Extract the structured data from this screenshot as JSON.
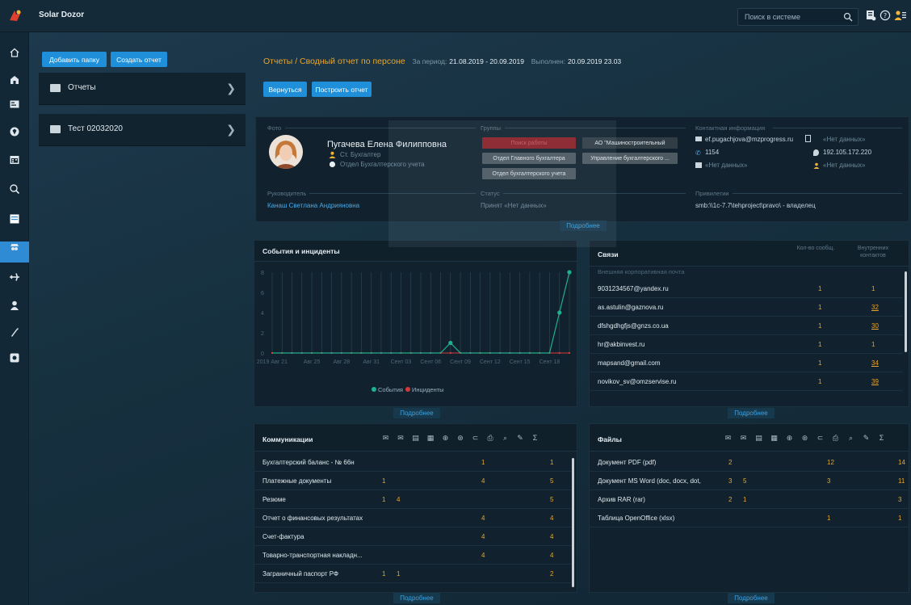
{
  "app": {
    "name": "Solar Dozor"
  },
  "search": {
    "placeholder": "Поиск в системе"
  },
  "leftpane": {
    "add_folder": "Добавить папку",
    "create_report": "Создать отчет",
    "folders": [
      {
        "label": "Отчеты"
      },
      {
        "label": "Тест 02032020"
      }
    ]
  },
  "breadcrumb": {
    "title": "Отчеты / Сводный отчет по персоне",
    "period_label": "За период:",
    "period_value": "21.08.2019 - 20.09.2019",
    "done_label": "Выполнен:",
    "done_value": "20.09.2019 23.03"
  },
  "actions": {
    "back": "Вернуться",
    "build": "Построить отчет"
  },
  "person": {
    "section_photo": "Фото",
    "name": "Пугачева Елена Филипповна",
    "position": "Ст. Бухгалтер",
    "department": "Отдел Бухгалтерского учета",
    "section_manager": "Руководитель",
    "manager": "Канаш Светлана Андрияновна",
    "section_groups": "Группы",
    "groups": [
      "Поиск работы",
      "АО \"Машиностроительный",
      "Отдел Главного бухгалтера",
      "Управление бухгалтерского ...",
      "Отдел бухгалтерского учета"
    ],
    "section_status": "Статус",
    "status": "Принят «Нет данных»",
    "section_contacts": "Контактная информация",
    "email": "ef.pugachjova@mzprogress.ru",
    "phone": "1154",
    "ip": "192.105.172.220",
    "no_data": "«Нет данных»",
    "section_rights": "Привилегии",
    "rights": "smb:\\\\1c-7.7\\tehproject\\pravo\\ - владелец",
    "more": "Подробнее"
  },
  "events": {
    "title": "События и инциденты",
    "more": "Подробнее",
    "legend": {
      "events": "События",
      "incidents": "Инциденты"
    },
    "colors": {
      "events": "#1fb08e",
      "incidents": "#d23a3a"
    }
  },
  "chart_data": {
    "type": "line",
    "x": [
      "2019 Авг 21",
      "Авг 22",
      "Авг 23",
      "Авг 24",
      "Авг 25",
      "Авг 26",
      "Авг 27",
      "Авг 28",
      "Авг 29",
      "Авг 30",
      "Авг 31",
      "Сент 01",
      "Сент 02",
      "Сент 03",
      "Сент 04",
      "Сент 05",
      "Сент 06",
      "Сент 07",
      "Сент 08",
      "Сент 09",
      "Сент 10",
      "Сент 11",
      "Сент 12",
      "Сент 13",
      "Сент 14",
      "Сент 15",
      "Сент 16",
      "Сент 17",
      "Сент 18",
      "Сент 19",
      "Сент 20"
    ],
    "xticks": [
      "2019 Авг 21",
      "Авг 25",
      "Авг 28",
      "Авг 31",
      "Сент 03",
      "Сент 06",
      "Сент 09",
      "Сент 12",
      "Сент 15",
      "Сент 18"
    ],
    "yticks": [
      "0",
      "2",
      "4",
      "6",
      "8"
    ],
    "ylim": [
      0,
      8
    ],
    "series": [
      {
        "name": "События",
        "values": [
          0,
          0,
          0,
          0,
          0,
          0,
          0,
          0,
          0,
          0,
          0,
          0,
          0,
          0,
          0,
          0,
          0,
          0,
          1,
          0,
          0,
          0,
          0,
          0,
          0,
          0,
          0,
          0,
          0,
          4,
          8
        ]
      },
      {
        "name": "Инциденты",
        "values": [
          0,
          0,
          0,
          0,
          0,
          0,
          0,
          0,
          0,
          0,
          0,
          0,
          0,
          0,
          0,
          0,
          0,
          0,
          0,
          0,
          0,
          0,
          0,
          0,
          0,
          0,
          0,
          0,
          0,
          0,
          0
        ]
      }
    ]
  },
  "links": {
    "title": "Связи",
    "col1": "Кол-во сообщ.",
    "col2": "Внутренних контактов",
    "group": "Внешняя корпоративная почта",
    "more": "Подробнее",
    "rows": [
      {
        "email": "9031234567@yandex.ru",
        "count": "1",
        "internal": "1"
      },
      {
        "email": "as.astulin@gaznova.ru",
        "count": "1",
        "internal": "32"
      },
      {
        "email": "dfshgdhgfjs@gnzs.co.ua",
        "count": "1",
        "internal": "30"
      },
      {
        "email": "hr@akbinvest.ru",
        "count": "1",
        "internal": "1"
      },
      {
        "email": "mapsand@gmail.com",
        "count": "1",
        "internal": "34"
      },
      {
        "email": "novikov_sv@omzservise.ru",
        "count": "1",
        "internal": "39"
      }
    ]
  },
  "communications": {
    "title": "Коммуникации",
    "more": "Подробнее",
    "rows": [
      {
        "name": "Бухгалтерский баланс - № 66н",
        "a": "",
        "b": "",
        "c": "1",
        "total": "1"
      },
      {
        "name": "Платежные документы",
        "a": "1",
        "b": "",
        "c": "4",
        "total": "5"
      },
      {
        "name": "Резюме",
        "a": "1",
        "b": "4",
        "c": "",
        "total": "5"
      },
      {
        "name": "Отчет о финансовых результатах",
        "a": "",
        "b": "",
        "c": "4",
        "total": "4"
      },
      {
        "name": "Счет-фактура",
        "a": "",
        "b": "",
        "c": "4",
        "total": "4"
      },
      {
        "name": "Товарно-транспортная накладн...",
        "a": "",
        "b": "",
        "c": "4",
        "total": "4"
      },
      {
        "name": "Заграничный паспорт РФ",
        "a": "1",
        "b": "1",
        "c": "",
        "total": "2"
      }
    ]
  },
  "files": {
    "title": "Файлы",
    "more": "Подробнее",
    "rows": [
      {
        "name": "Документ PDF (pdf)",
        "a": "2",
        "b": "",
        "c": "12",
        "total": "14"
      },
      {
        "name": "Документ MS Word (doc, docx, dot,",
        "a": "3",
        "b": "5",
        "c": "3",
        "total": "11"
      },
      {
        "name": "Архив RAR (rar)",
        "a": "2",
        "b": "1",
        "c": "",
        "total": "3"
      },
      {
        "name": "Таблица OpenOffice (xlsx)",
        "a": "",
        "b": "",
        "c": "1",
        "total": "1"
      }
    ]
  },
  "header_icons": [
    "mail-icon",
    "mail-open-icon",
    "doc-icon",
    "print-icon",
    "web-icon",
    "skype-icon",
    "usb-icon",
    "printer-icon",
    "search-icon",
    "edit-icon",
    "sum-icon"
  ]
}
